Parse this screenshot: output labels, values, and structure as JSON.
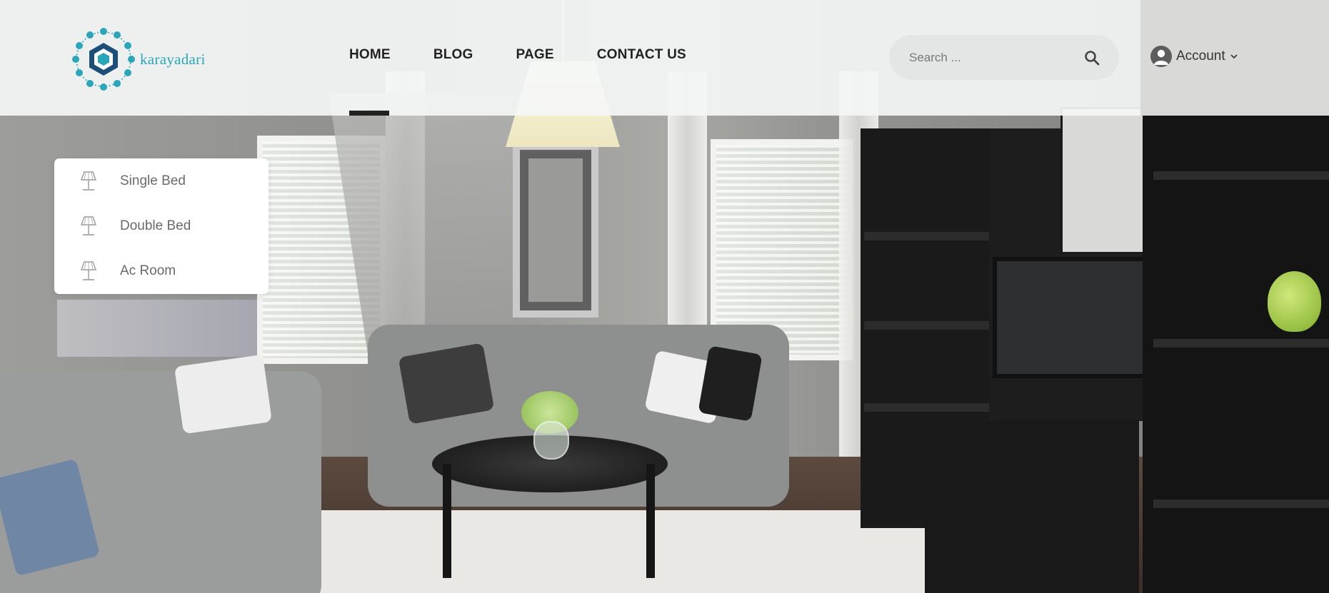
{
  "brand": {
    "name": "karayadari"
  },
  "nav": {
    "items": [
      {
        "label": "HOME",
        "active": true
      },
      {
        "label": "BLOG",
        "active": false
      },
      {
        "label": "PAGE",
        "active": false
      },
      {
        "label": "CONTACT US",
        "active": false
      }
    ]
  },
  "search": {
    "placeholder": "Search ...",
    "icon": "search-icon"
  },
  "account": {
    "label": "Account",
    "icon": "user-icon",
    "chevron": "chevron-down-icon"
  },
  "dropdown": {
    "items": [
      {
        "label": "Single Bed",
        "icon": "lamp-icon"
      },
      {
        "label": "Double Bed",
        "icon": "lamp-icon"
      },
      {
        "label": "Ac Room",
        "icon": "lamp-icon"
      }
    ]
  },
  "colors": {
    "brand": "#2aa6b8",
    "logo_dark": "#1b4f7a",
    "nav_text": "#222222"
  }
}
